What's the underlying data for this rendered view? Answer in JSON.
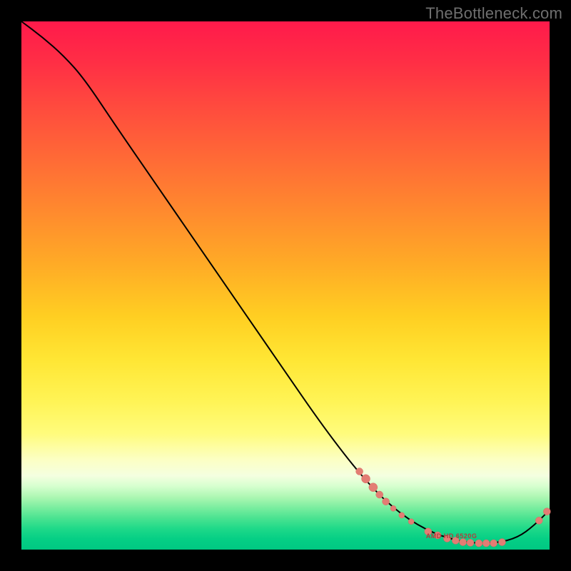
{
  "watermark": "TheBottleneck.com",
  "series_label": "AMD HD 6520G",
  "colors": {
    "curve": "#000000",
    "marker_fill": "#e37d74",
    "marker_stroke": "#d86a61"
  },
  "chart_data": {
    "type": "line",
    "title": "",
    "xlabel": "",
    "ylabel": "",
    "xlim": [
      0,
      100
    ],
    "ylim": [
      0,
      100
    ],
    "curve": [
      {
        "x": 0,
        "y": 100
      },
      {
        "x": 4,
        "y": 97
      },
      {
        "x": 8,
        "y": 93.5
      },
      {
        "x": 12,
        "y": 89
      },
      {
        "x": 18,
        "y": 80
      },
      {
        "x": 28,
        "y": 65.5
      },
      {
        "x": 38,
        "y": 51
      },
      {
        "x": 48,
        "y": 36.5
      },
      {
        "x": 58,
        "y": 22
      },
      {
        "x": 66,
        "y": 12
      },
      {
        "x": 72,
        "y": 6.5
      },
      {
        "x": 78,
        "y": 3
      },
      {
        "x": 84,
        "y": 1.3
      },
      {
        "x": 90,
        "y": 1.2
      },
      {
        "x": 94,
        "y": 2.3
      },
      {
        "x": 97,
        "y": 4.5
      },
      {
        "x": 100,
        "y": 7.5
      }
    ],
    "markers": [
      {
        "x": 64.0,
        "y": 14.8,
        "r": 5
      },
      {
        "x": 65.2,
        "y": 13.4,
        "r": 6
      },
      {
        "x": 66.6,
        "y": 11.8,
        "r": 6
      },
      {
        "x": 67.8,
        "y": 10.4,
        "r": 5
      },
      {
        "x": 69.0,
        "y": 9.1,
        "r": 5
      },
      {
        "x": 70.4,
        "y": 7.8,
        "r": 4
      },
      {
        "x": 72.0,
        "y": 6.5,
        "r": 4
      },
      {
        "x": 73.8,
        "y": 5.3,
        "r": 4
      },
      {
        "x": 77.0,
        "y": 3.4,
        "r": 5
      },
      {
        "x": 78.8,
        "y": 2.7,
        "r": 5
      },
      {
        "x": 80.6,
        "y": 2.1,
        "r": 5
      },
      {
        "x": 82.2,
        "y": 1.7,
        "r": 5
      },
      {
        "x": 83.6,
        "y": 1.4,
        "r": 5
      },
      {
        "x": 85.0,
        "y": 1.3,
        "r": 5
      },
      {
        "x": 86.6,
        "y": 1.2,
        "r": 5
      },
      {
        "x": 88.0,
        "y": 1.2,
        "r": 5
      },
      {
        "x": 89.4,
        "y": 1.2,
        "r": 5
      },
      {
        "x": 91.0,
        "y": 1.4,
        "r": 5
      },
      {
        "x": 98.0,
        "y": 5.5,
        "r": 5
      },
      {
        "x": 99.5,
        "y": 7.2,
        "r": 5
      }
    ],
    "label_anchor": {
      "x": 82,
      "y": 2.5
    }
  }
}
